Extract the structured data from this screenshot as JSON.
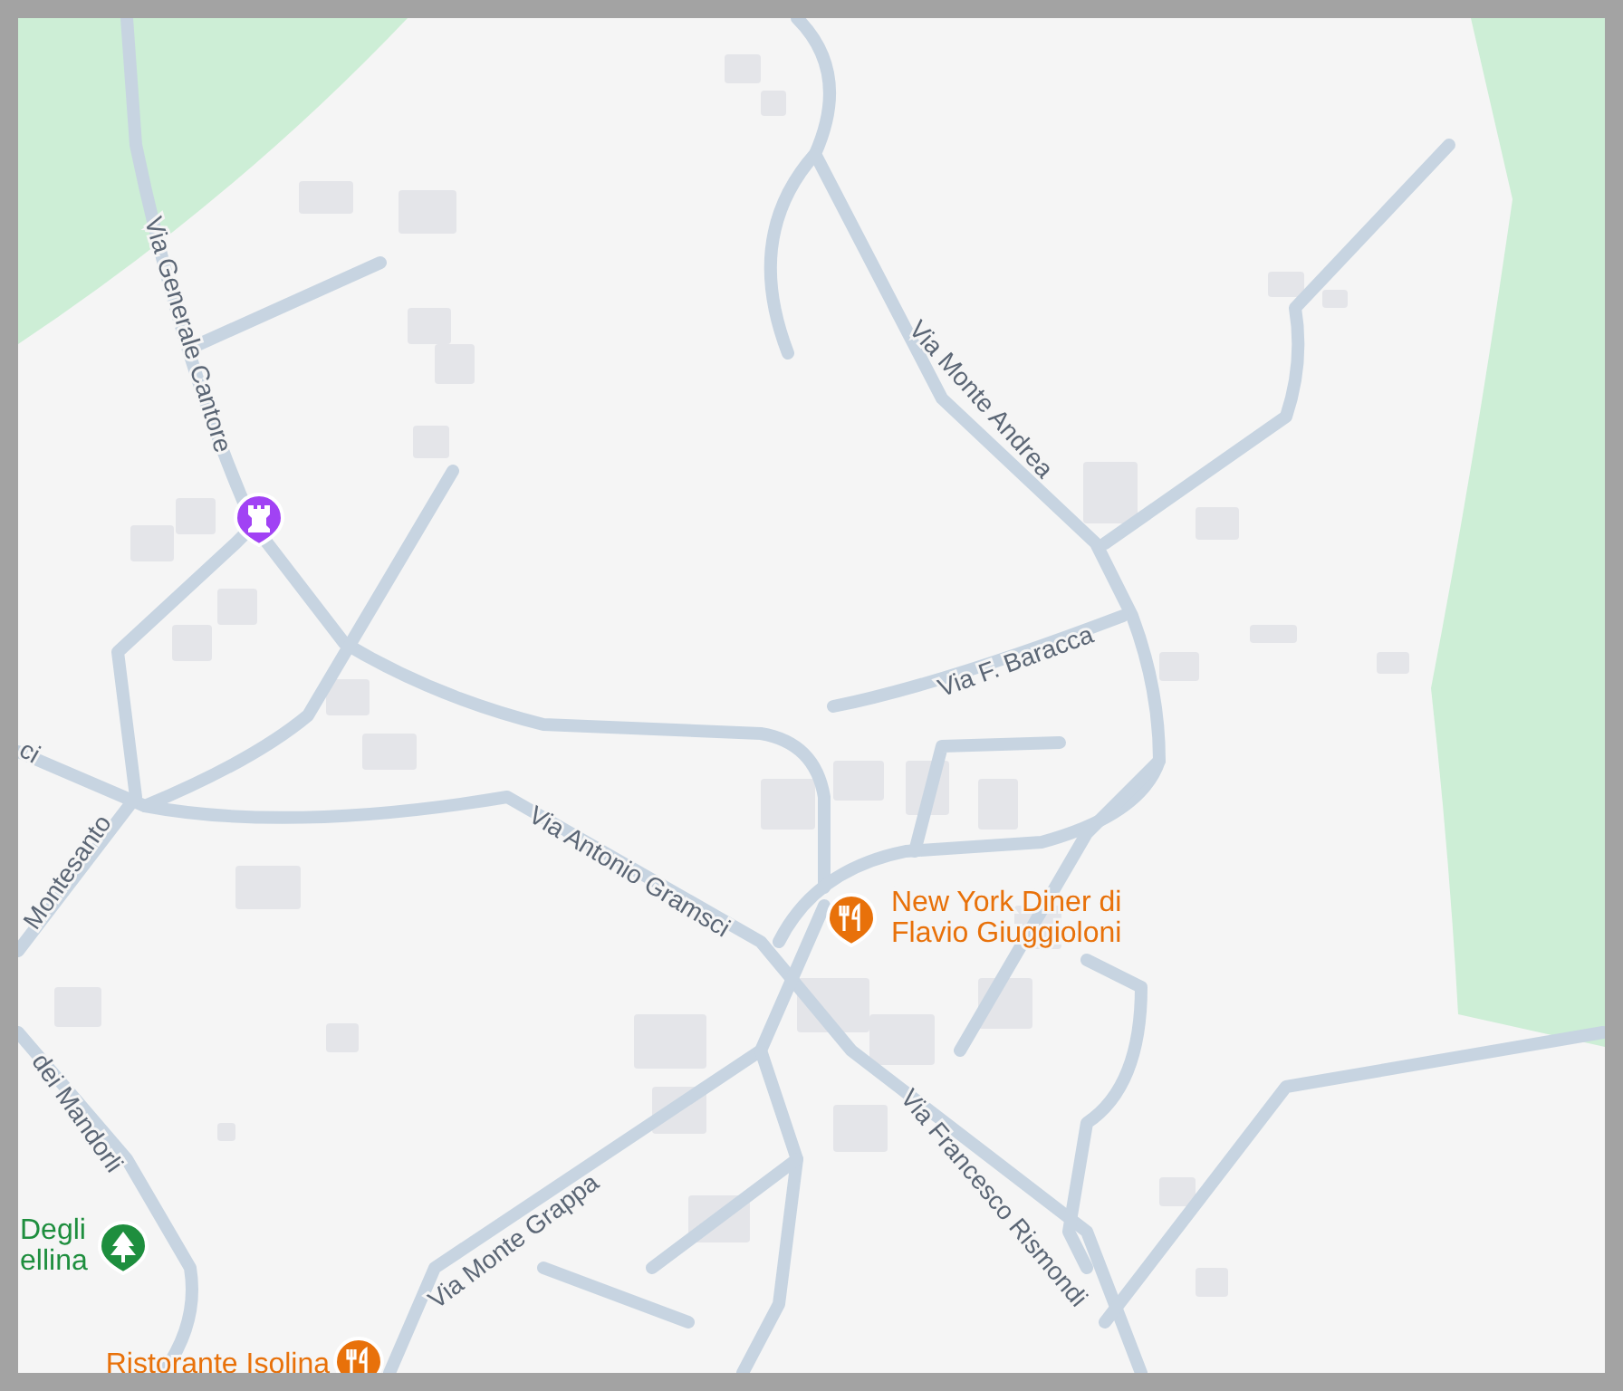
{
  "map": {
    "street_labels": [
      {
        "text": "Via Generale Cantore"
      },
      {
        "text": "Via Monte Andrea"
      },
      {
        "text": "Via F. Baracca"
      },
      {
        "text": "Via Antonio Gramsci"
      },
      {
        "text": "Via Francesco Rismondi"
      },
      {
        "text": "Via Monte Grappa"
      },
      {
        "text": "Montesanto"
      },
      {
        "text": "ci"
      },
      {
        "text": "dei Mandorli"
      }
    ],
    "places": [
      {
        "kind": "restaurant",
        "lines": [
          "New York Diner di",
          "Flavio Giuggioloni"
        ]
      },
      {
        "kind": "park",
        "lines": [
          "Degli",
          "ellina"
        ]
      },
      {
        "kind": "restaurant",
        "lines": [
          "Ristorante Isolina"
        ]
      }
    ],
    "markers": [
      {
        "kind": "landmark"
      }
    ]
  }
}
